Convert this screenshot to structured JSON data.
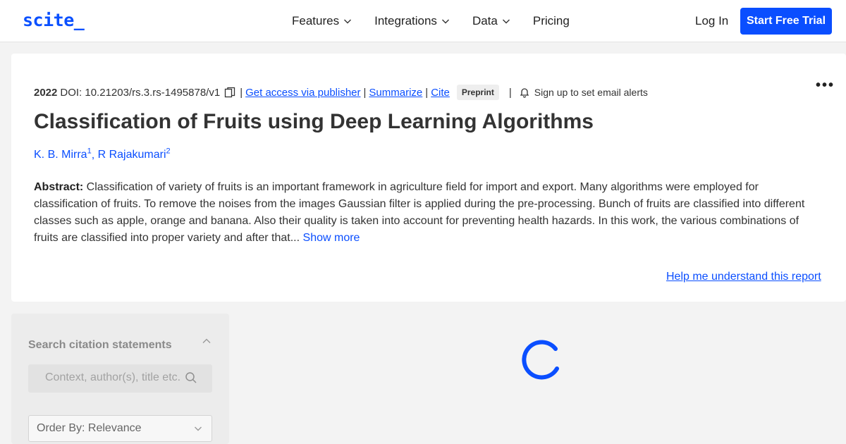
{
  "header": {
    "logo": "scite_",
    "nav": [
      {
        "label": "Features",
        "has_dropdown": true
      },
      {
        "label": "Integrations",
        "has_dropdown": true
      },
      {
        "label": "Data",
        "has_dropdown": true
      },
      {
        "label": "Pricing",
        "has_dropdown": false
      }
    ],
    "login_label": "Log In",
    "trial_label": "Start Free Trial"
  },
  "paper": {
    "year": "2022",
    "doi": "DOI: 10.21203/rs.3.rs-1495878/v1",
    "links": {
      "access": "Get access via publisher",
      "summarize": "Summarize",
      "cite": "Cite"
    },
    "badge": "Preprint",
    "alerts": "Sign up to set email alerts",
    "title": "Classification of Fruits using Deep Learning Algorithms",
    "authors": [
      {
        "name": "K. B. Mirra",
        "sup": "1"
      },
      {
        "name": "R Rajakumari",
        "sup": "2"
      }
    ],
    "abstract_label": "Abstract:",
    "abstract_text": " Classification of variety of fruits is an important framework in agriculture field for import and export. Many algorithms were employed for classification of fruits. To remove the noises from the images Gaussian filter is applied during the pre-processing. Bunch of fruits are classified into different classes such as apple, orange and banana. Also their quality is taken into account for preventing health hazards. In this work, the various combinations of fruits are classified into proper variety and after that...",
    "show_more": "Show more",
    "help_link": "Help me understand this report"
  },
  "sidebar": {
    "title": "Search citation statements",
    "search_placeholder": "Context, author(s), title etc.",
    "order_by": "Order By: Relevance"
  },
  "colors": {
    "accent": "#0a4eff",
    "background": "#f3f3f3"
  }
}
